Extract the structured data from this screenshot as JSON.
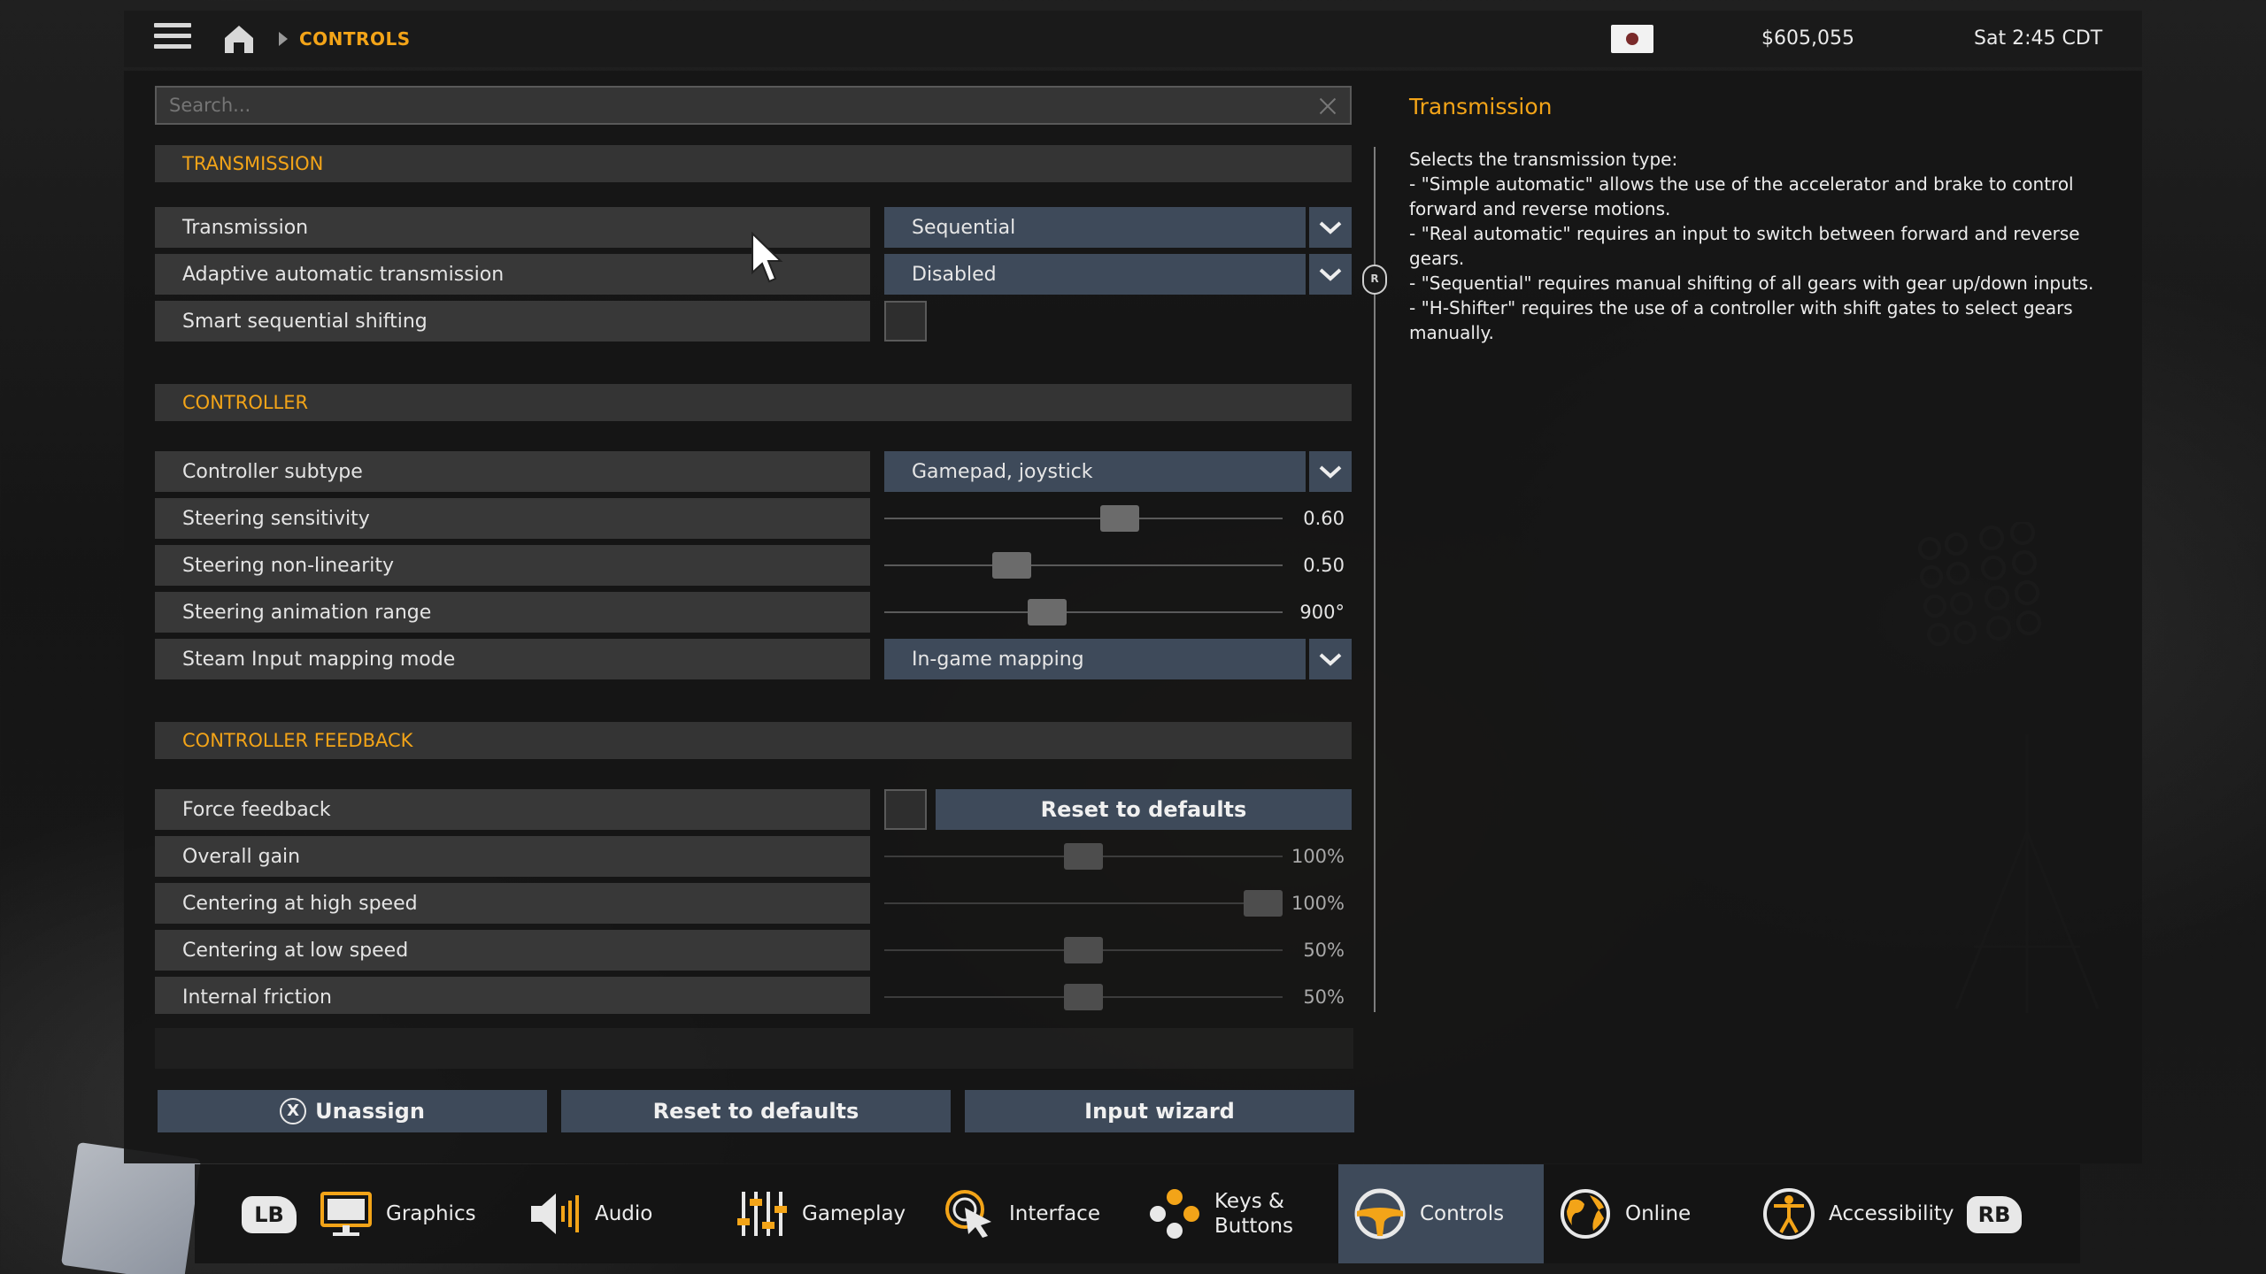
{
  "breadcrumb": {
    "current": "CONTROLS"
  },
  "status": {
    "money": "$605,055",
    "time": "Sat 2:45 CDT"
  },
  "search": {
    "placeholder": "Search..."
  },
  "sections": {
    "transmission": {
      "title": "TRANSMISSION",
      "transmission_label": "Transmission",
      "transmission_value": "Sequential",
      "adaptive_label": "Adaptive automatic transmission",
      "adaptive_value": "Disabled",
      "smart_label": "Smart sequential shifting",
      "smart_checked": false
    },
    "controller": {
      "title": "CONTROLLER",
      "subtype_label": "Controller subtype",
      "subtype_value": "Gamepad, joystick",
      "sensitivity_label": "Steering sensitivity",
      "sensitivity_value": "0.60",
      "sensitivity_level": 0.6,
      "nonlinearity_label": "Steering non-linearity",
      "nonlinearity_value": "0.50",
      "nonlinearity_level": 0.3,
      "anim_label": "Steering animation range",
      "anim_value": "900°",
      "anim_level": 0.4,
      "steam_label": "Steam Input mapping mode",
      "steam_value": "In-game mapping"
    },
    "feedback": {
      "title": "CONTROLLER FEEDBACK",
      "force_label": "Force feedback",
      "force_checked": false,
      "reset_label": "Reset to defaults",
      "gain_label": "Overall gain",
      "gain_value": "100%",
      "gain_level": 0.5,
      "high_label": "Centering at high speed",
      "high_value": "100%",
      "high_level": 1.0,
      "low_label": "Centering at low speed",
      "low_value": "50%",
      "low_level": 0.5,
      "friction_label": "Internal friction",
      "friction_value": "50%",
      "friction_level": 0.5
    }
  },
  "description": {
    "title": "Transmission",
    "lines": [
      "Selects the transmission type:",
      "- \"Simple automatic\" allows the use of the accelerator and brake to control forward and reverse motions.",
      "- \"Real automatic\" requires an input to switch between forward and reverse gears.",
      "- \"Sequential\" requires manual shifting of all gears with gear up/down inputs.",
      "- \"H-Shifter\" requires the use of a controller with shift gates to select gears manually."
    ]
  },
  "scroll_badge": "R",
  "actions": {
    "unassign_badge": "X",
    "unassign": "Unassign",
    "reset": "Reset to defaults",
    "wizard": "Input wizard"
  },
  "nav": {
    "lb": "LB",
    "rb": "RB",
    "graphics": "Graphics",
    "audio": "Audio",
    "gameplay": "Gameplay",
    "interface": "Interface",
    "keys_line1": "Keys &",
    "keys_line2": "Buttons",
    "controls": "Controls",
    "online": "Online",
    "accessibility": "Accessibility",
    "active": "controls"
  },
  "colors": {
    "accent": "#f3a418",
    "button": "#3e4a5a",
    "row": "#383838"
  }
}
